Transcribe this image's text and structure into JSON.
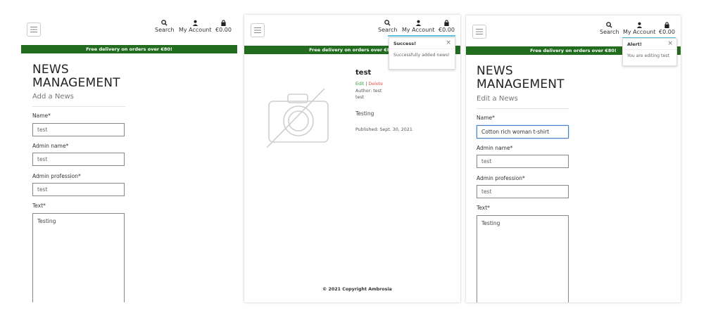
{
  "colors": {
    "banner_bg": "#216c1e",
    "accent_underline": "#5bc0de",
    "edit_link": "#3c9a3c",
    "delete_link": "#d9534f",
    "focus_border": "#4a7ec7"
  },
  "nav": {
    "search_label": "Search",
    "account_label": "My Account",
    "bag_label": "€0.00",
    "icons": [
      "menu-icon",
      "search-icon",
      "user-icon",
      "shopping-bag-icon"
    ]
  },
  "banner": {
    "text": "Free delivery on orders over €80!"
  },
  "add_form": {
    "title_line1": "NEWS",
    "title_line2": "MANAGEMENT",
    "subtitle": "Add a News",
    "name_label": "Name*",
    "name_value": "test",
    "admin_name_label": "Admin name*",
    "admin_name_value": "test",
    "admin_profession_label": "Admin profession*",
    "admin_profession_value": "test",
    "text_label": "Text*",
    "text_value": "Testing"
  },
  "detail": {
    "title": "test",
    "edit_label": "Edit",
    "separator": "|",
    "delete_label": "Delete",
    "author_line": "Author: test",
    "author_sub": "test",
    "body": "Testing",
    "published": "Published: Sept. 30, 2021",
    "footer": "© 2021 Copyright Ambrosia",
    "image_icon": "no-image-camera-icon"
  },
  "success_toast": {
    "title": "Success!",
    "message": "Successfully added news!",
    "close": "×",
    "accent": "#5cb85c"
  },
  "edit_form": {
    "title_line1": "NEWS",
    "title_line2": "MANAGEMENT",
    "subtitle": "Edit a News",
    "name_label": "Name*",
    "name_value": "Cotton rich woman t-shirt",
    "admin_name_label": "Admin name*",
    "admin_name_value": "test",
    "admin_profession_label": "Admin profession*",
    "admin_profession_value": "test",
    "text_label": "Text*",
    "text_value": "Testing"
  },
  "alert_toast": {
    "title": "Alert!",
    "message": "You are editing test",
    "close": "×",
    "accent": "#5bc0de"
  }
}
